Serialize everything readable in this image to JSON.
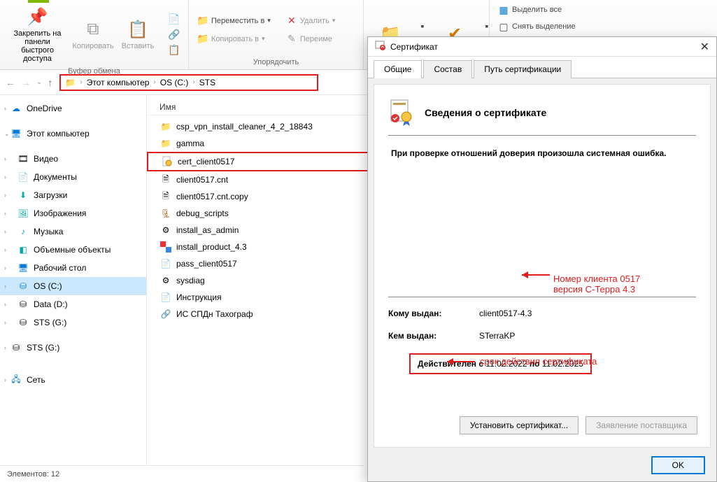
{
  "ribbon": {
    "pin": "Закрепить на панели быстрого доступа",
    "copy": "Копировать",
    "paste": "Вставить",
    "move_to": "Переместить в",
    "copy_to": "Копировать в",
    "delete": "Удалить",
    "rename": "Переиме",
    "select_all": "Выделить все",
    "deselect": "Снять выделение",
    "group_buffer": "Буфер обмена",
    "group_organize": "Упорядочить"
  },
  "breadcrumb": {
    "root": "Этот компьютер",
    "os": "OS (C:)",
    "folder": "STS"
  },
  "sidebar": {
    "onedrive": "OneDrive",
    "this_pc": "Этот компьютер",
    "videos": "Видео",
    "documents": "Документы",
    "downloads": "Загрузки",
    "pictures": "Изображения",
    "music": "Музыка",
    "objects3d": "Объемные объекты",
    "desktop": "Рабочий стол",
    "os_c": "OS (C:)",
    "data_d": "Data (D:)",
    "sts_g1": "STS (G:)",
    "sts_g2": "STS (G:)",
    "network": "Сеть"
  },
  "files": {
    "header_name": "Имя",
    "items": [
      {
        "name": "csp_vpn_install_cleaner_4_2_18843",
        "type": "folder"
      },
      {
        "name": "gamma",
        "type": "folder"
      },
      {
        "name": "cert_client0517",
        "type": "cert",
        "highlighted": true
      },
      {
        "name": "client0517.cnt",
        "type": "file"
      },
      {
        "name": "client0517.cnt.copy",
        "type": "file"
      },
      {
        "name": "debug_scripts",
        "type": "archive"
      },
      {
        "name": "install_as_admin",
        "type": "bat"
      },
      {
        "name": "install_product_4.3",
        "type": "exe"
      },
      {
        "name": "pass_client0517",
        "type": "text"
      },
      {
        "name": "sysdiag",
        "type": "bat"
      },
      {
        "name": "Инструкция",
        "type": "text"
      },
      {
        "name": "ИС СПДн Тахограф",
        "type": "link"
      }
    ]
  },
  "status": "Элементов: 12",
  "cert": {
    "title": "Сертификат",
    "tab_general": "Общие",
    "tab_details": "Состав",
    "tab_path": "Путь сертификации",
    "heading": "Сведения о сертификате",
    "error_line": "При проверке отношений доверия произошла системная ошибка.",
    "issued_to_label": "Кому выдан:",
    "issued_to": "client0517-4.3",
    "issued_by_label": "Кем выдан:",
    "issued_by": "STerraKP",
    "valid_prefix": "Действителен с",
    "valid_from": "11.02.2022",
    "valid_mid": "по",
    "valid_to": "11.02.2025",
    "install_btn": "Установить сертификат...",
    "statement_btn": "Заявление поставщика",
    "ok": "OK"
  },
  "annotations": {
    "client_num": "Номер клиента 0517",
    "version": "версия С-Терра 4.3",
    "validity": "срок действия сертификата"
  }
}
